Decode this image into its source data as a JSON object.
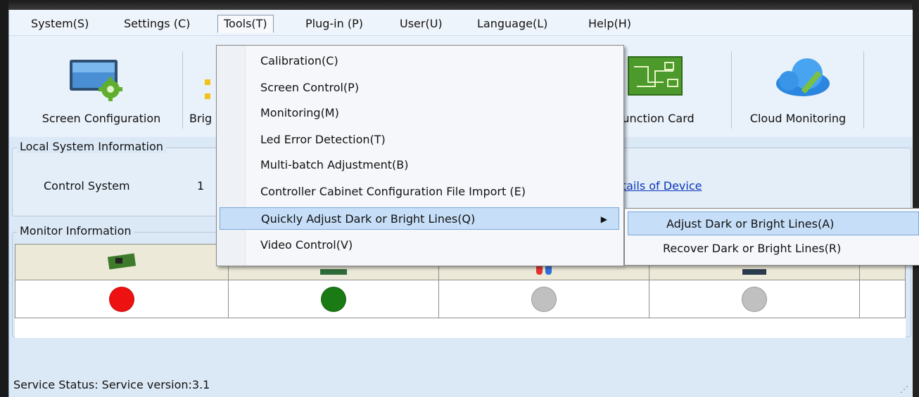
{
  "menubar": {
    "items": [
      "System(S)",
      "Settings (C)",
      "Tools(T)",
      "Plug-in (P)",
      "User(U)",
      "Language(L)",
      "Help(H)"
    ]
  },
  "toolbar": {
    "screen_configuration": "Screen Configuration",
    "brightness_partial": "Brig",
    "multifunction_card_partial": "-function Card",
    "cloud_monitoring": "Cloud Monitoring"
  },
  "local_system": {
    "title": "Local System Information",
    "control_system_label": "Control System",
    "control_system_count": "1",
    "details_link_partial": "etails of Device"
  },
  "monitor": {
    "title": "Monitor Information",
    "status_colors": [
      "#ee1111",
      "#1a7a14",
      "#c0c0c0",
      "#c0c0c0"
    ]
  },
  "tools_menu": {
    "items": [
      "Calibration(C)",
      "Screen Control(P)",
      "Monitoring(M)",
      "Led Error Detection(T)",
      "Multi-batch Adjustment(B)",
      "Controller Cabinet Configuration File Import (E)",
      "Quickly Adjust Dark or Bright Lines(Q)",
      "Video Control(V)"
    ],
    "highlighted_index": 6
  },
  "submenu": {
    "items": [
      "Adjust Dark or Bright Lines(A)",
      "Recover Dark or Bright Lines(R)"
    ]
  },
  "status_bar": {
    "text": "Service Status:  Service version:3.1"
  }
}
